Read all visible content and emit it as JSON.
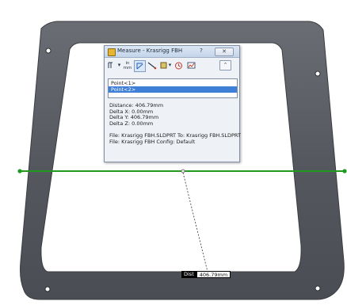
{
  "dialog": {
    "title": "Measure - Krasrigg FBH",
    "help_glyph": "?",
    "close_glyph": "✕",
    "collapse_glyph": "⌃"
  },
  "toolbar": {
    "units_label": "in mm",
    "arc_icon": "arc-circle-options-icon",
    "show_xyz_icon": "xyz-measurements-icon",
    "point_to_point_icon": "point-to-point-icon",
    "projection_icon": "projection-icon",
    "history_icon": "measurement-history-icon",
    "sensor_icon": "create-sensor-icon"
  },
  "selection": {
    "items": [
      "Point<1>",
      "Point<2>"
    ],
    "selected_index": 1
  },
  "results": {
    "distance": "Distance: 406.79mm",
    "delta_x": "Delta X: 0.00mm",
    "delta_y": "Delta Y: 406.79mm",
    "delta_z": "Delta Z: 0.00mm",
    "file_line": "File: Krasrigg FBH.SLDPRT To: Krasrigg FBH.SLDPRT",
    "config_line": "File: Krasrigg FBH Config: Default"
  },
  "dimension_tag": {
    "label": "Dist",
    "value": "406.79mm"
  },
  "colors": {
    "part_fill": "#5b5e64",
    "measure_line": "#1f9a1f",
    "selection_blue": "#3f7fd6"
  }
}
